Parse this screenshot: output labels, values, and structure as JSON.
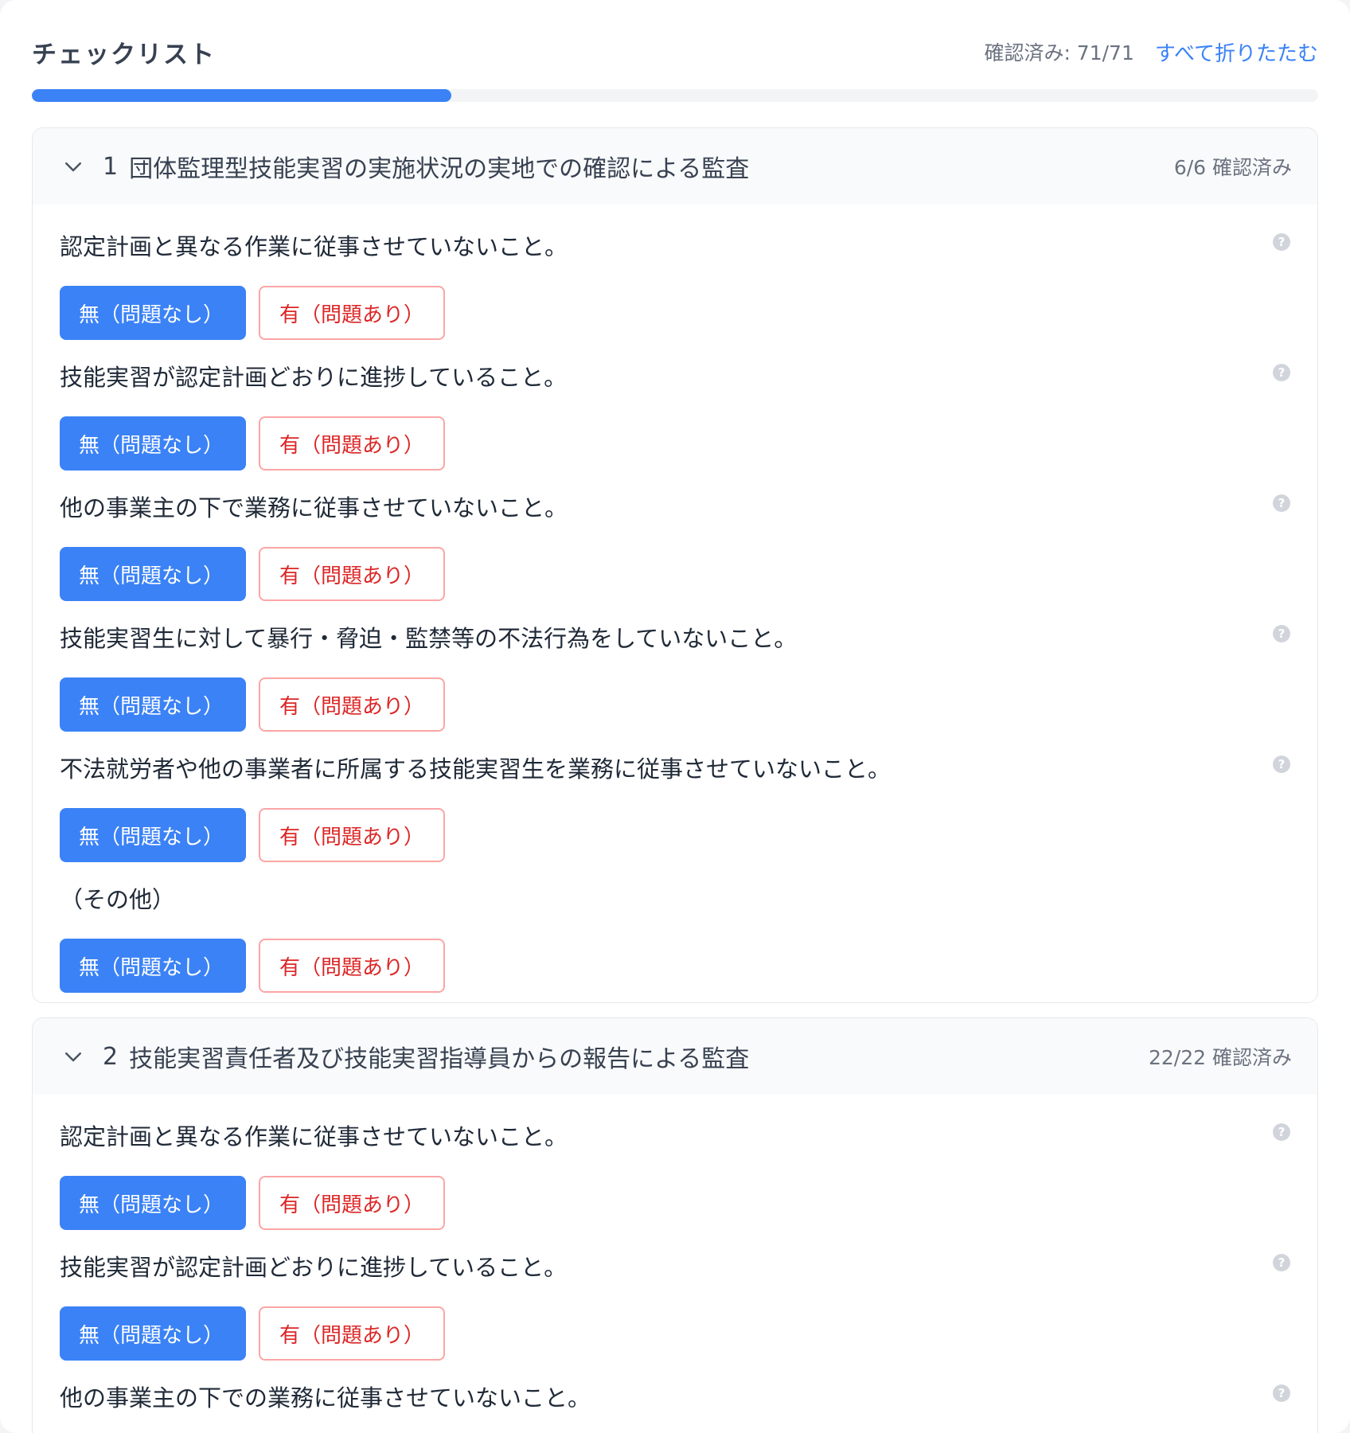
{
  "header": {
    "title": "チェックリスト",
    "count_label": "確認済み: 71/71",
    "collapse_all": "すべて折りたたむ"
  },
  "progress": {
    "fraction": 0.326
  },
  "buttons": {
    "ok": "無（問題なし）",
    "ng": "有（問題あり）"
  },
  "help_icon": "?",
  "sections": [
    {
      "number": "1",
      "title": "団体監理型技能実習の実施状況の実地での確認による監査",
      "status": "6/6 確認済み",
      "items": [
        {
          "text": "認定計画と異なる作業に従事させていないこと。"
        },
        {
          "text": "技能実習が認定計画どおりに進捗していること。"
        },
        {
          "text": "他の事業主の下で業務に従事させていないこと。"
        },
        {
          "text": "技能実習生に対して暴行・脅迫・監禁等の不法行為をしていないこと。"
        },
        {
          "text": "不法就労者や他の事業者に所属する技能実習生を業務に従事させていないこと。"
        },
        {
          "text": "（その他）"
        }
      ]
    },
    {
      "number": "2",
      "title": "技能実習責任者及び技能実習指導員からの報告による監査",
      "status": "22/22 確認済み",
      "items": [
        {
          "text": "認定計画と異なる作業に従事させていないこと。"
        },
        {
          "text": "技能実習が認定計画どおりに進捗していること。"
        },
        {
          "text": "他の事業主の下での業務に従事させていないこと。"
        }
      ]
    }
  ]
}
